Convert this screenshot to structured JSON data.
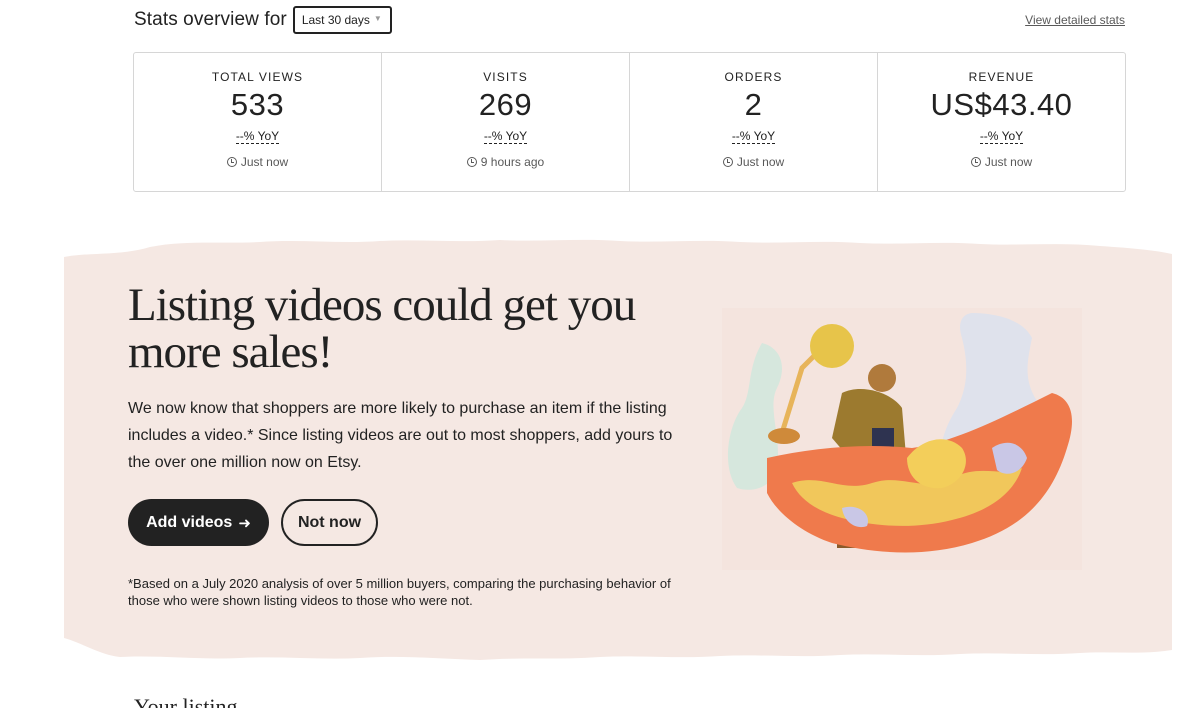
{
  "stats": {
    "title": "Stats overview for",
    "period": "Last 30 days",
    "detail_link": "View detailed stats",
    "cards": [
      {
        "label": "TOTAL VIEWS",
        "value": "533",
        "yoy": "--% YoY",
        "updated": "Just now"
      },
      {
        "label": "VISITS",
        "value": "269",
        "yoy": "--% YoY",
        "updated": "9 hours ago"
      },
      {
        "label": "ORDERS",
        "value": "2",
        "yoy": "--% YoY",
        "updated": "Just now"
      },
      {
        "label": "REVENUE",
        "value": "US$43.40",
        "yoy": "--% YoY",
        "updated": "Just now"
      }
    ]
  },
  "promo": {
    "title": "Listing videos could get you more sales!",
    "body": "We now know that shoppers are more likely to purchase an item if the listing includes a video.* Since listing videos are out to most shoppers, add yours to the over one million now on Etsy.",
    "add_button": "Add videos",
    "add_button_icon": "arrow-right-icon",
    "dismiss_button": "Not now",
    "footnote": "*Based on a July 2020 analysis of over 5 million buyers, comparing the purchasing behavior of those who were shown listing videos to those who were not.",
    "background_color": "#f5e8e3"
  },
  "next_section": {
    "heading": "Your listing..."
  }
}
